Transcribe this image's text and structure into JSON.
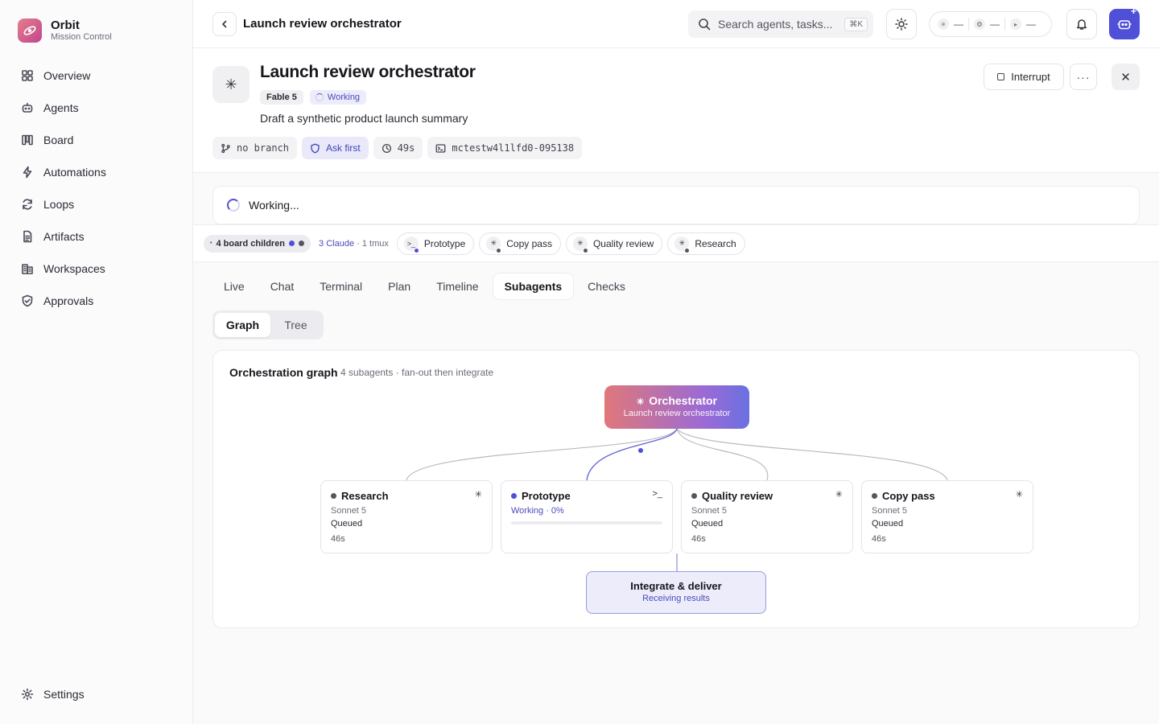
{
  "app": {
    "name": "Orbit",
    "subtitle": "Mission Control",
    "accent": "#4f4fd8"
  },
  "sidebar": {
    "items": [
      {
        "label": "Overview",
        "icon": "grid-icon"
      },
      {
        "label": "Agents",
        "icon": "bot-icon"
      },
      {
        "label": "Board",
        "icon": "columns-icon"
      },
      {
        "label": "Automations",
        "icon": "bolt-icon"
      },
      {
        "label": "Loops",
        "icon": "refresh-icon"
      },
      {
        "label": "Artifacts",
        "icon": "document-icon"
      },
      {
        "label": "Workspaces",
        "icon": "building-icon"
      },
      {
        "label": "Approvals",
        "icon": "shield-check-icon"
      }
    ],
    "settings_label": "Settings"
  },
  "topbar": {
    "title": "Launch review orchestrator",
    "search_placeholder": "Search agents, tasks...",
    "search_shortcut": "⌘K",
    "status": [
      {
        "icon": "asterisk-icon",
        "value": "—"
      },
      {
        "icon": "gemini-icon",
        "value": "—"
      },
      {
        "icon": "play-icon",
        "value": "—"
      }
    ]
  },
  "header": {
    "title": "Launch review orchestrator",
    "model": "Fable 5",
    "status": "Working",
    "description": "Draft a synthetic product launch summary",
    "chips": {
      "branch": "no branch",
      "permission": "Ask first",
      "elapsed": "49s",
      "session": "mctestw4l1lfd0-095138"
    },
    "interrupt_label": "Interrupt"
  },
  "working": {
    "label": "Working..."
  },
  "children": {
    "summary": "4 board children",
    "meta_claude": "3 Claude",
    "meta_tmux": "· 1 tmux",
    "items": [
      {
        "label": "Prototype",
        "icon": ">_",
        "dot": "#4f4fd8"
      },
      {
        "label": "Copy pass",
        "icon": "✳",
        "dot": "#55555f"
      },
      {
        "label": "Quality review",
        "icon": "✳",
        "dot": "#55555f"
      },
      {
        "label": "Research",
        "icon": "✳",
        "dot": "#55555f"
      }
    ]
  },
  "tabs": [
    "Live",
    "Chat",
    "Terminal",
    "Plan",
    "Timeline",
    "Subagents",
    "Checks"
  ],
  "active_tab": "Subagents",
  "view_toggle": {
    "graph": "Graph",
    "tree": "Tree"
  },
  "graph": {
    "title": "Orchestration graph",
    "subtitle": "4 subagents · fan-out then integrate",
    "orchestrator": {
      "title": "Orchestrator",
      "subtitle": "Launch review orchestrator"
    },
    "nodes": [
      {
        "name": "Research",
        "model": "Sonnet 5",
        "status": "Queued",
        "time": "46s",
        "icon": "✳"
      },
      {
        "name": "Prototype",
        "status": "Working · 0%",
        "progress": 0,
        "icon": ">_"
      },
      {
        "name": "Quality review",
        "model": "Sonnet 5",
        "status": "Queued",
        "time": "46s",
        "icon": "✳"
      },
      {
        "name": "Copy pass",
        "model": "Sonnet 5",
        "status": "Queued",
        "time": "46s",
        "icon": "✳"
      }
    ],
    "integrate": {
      "title": "Integrate & deliver",
      "subtitle": "Receiving results"
    }
  }
}
